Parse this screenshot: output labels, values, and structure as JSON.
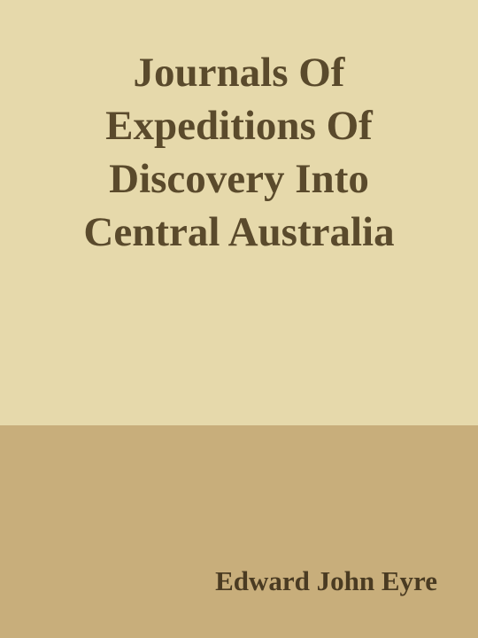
{
  "cover": {
    "title_lines": [
      "Journals Of",
      "Expeditions Of",
      "Discovery Into",
      "Central Australia"
    ],
    "author": "Edward John Eyre",
    "colors": {
      "top_background": "#e6d9ab",
      "bottom_background": "#c8ae7b",
      "title_text": "#5a4a2c",
      "author_text": "#4a3b22"
    }
  }
}
